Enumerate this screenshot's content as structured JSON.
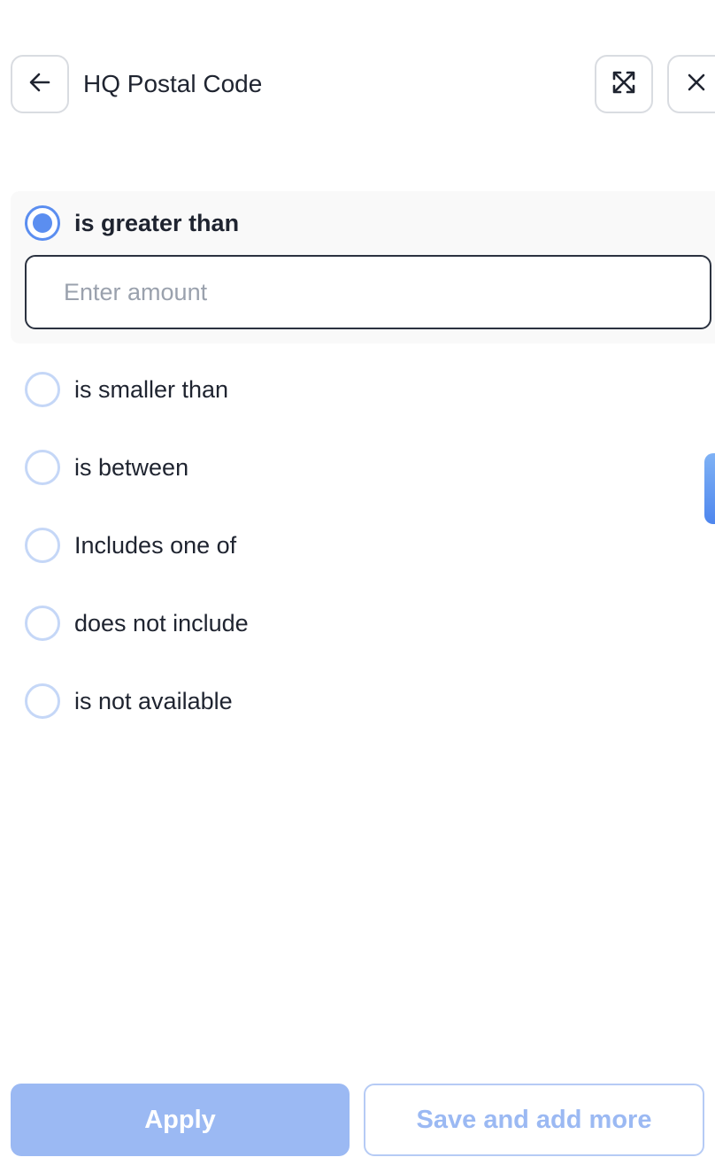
{
  "header": {
    "title": "HQ Postal Code",
    "back_icon": "arrow-left-icon",
    "expand_icon": "expand-arrows-icon",
    "close_icon": "close-icon"
  },
  "filter": {
    "input_placeholder": "Enter amount",
    "input_value": "",
    "options": [
      {
        "label": "is greater than",
        "selected": true
      },
      {
        "label": "is smaller than",
        "selected": false
      },
      {
        "label": "is between",
        "selected": false
      },
      {
        "label": "Includes one of",
        "selected": false
      },
      {
        "label": "does not include",
        "selected": false
      },
      {
        "label": "is not available",
        "selected": false
      }
    ]
  },
  "footer": {
    "apply_label": "Apply",
    "save_more_label": "Save and add more"
  },
  "colors": {
    "accent": "#5b8ef0",
    "accent_disabled": "#9bb9f3",
    "radio_border": "#c5d7f7"
  }
}
